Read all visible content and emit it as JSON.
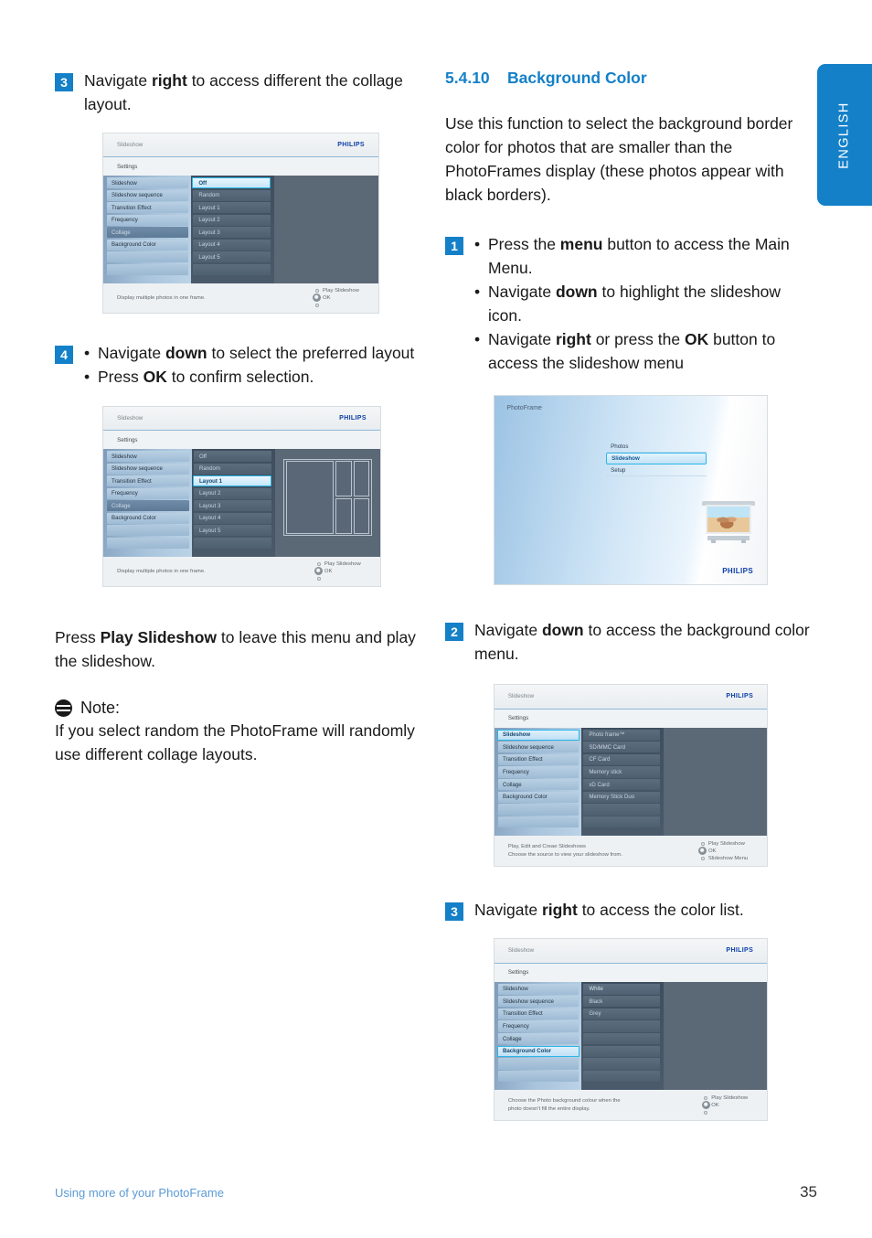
{
  "lang_tab": {
    "label": "ENGLISH"
  },
  "left_column": {
    "step3": {
      "badge": "3",
      "text_parts": [
        "Navigate ",
        "right",
        " to access different the collage layout."
      ],
      "full_text": "Navigate right to access different the collage layout."
    },
    "screenshot1": {
      "title": "Slideshow",
      "brand": "PHILIPS",
      "subtitle": "Settings",
      "menu_items": [
        "Slideshow",
        "Slideshow sequence",
        "Transition Effect",
        "Frequency",
        "Collage",
        "Background Color"
      ],
      "menu_selected": "Collage",
      "options": [
        "Off",
        "Random",
        "Layout 1",
        "Layout 2",
        "Layout 3",
        "Layout 4",
        "Layout 5"
      ],
      "option_selected": "Off",
      "footer_text": "Display multiple photos in one frame.",
      "controls": [
        "Play Slideshow",
        "OK"
      ]
    },
    "step4": {
      "badge": "4",
      "bullets": [
        "Navigate down to select the preferred layout",
        "Press OK to confirm selection."
      ]
    },
    "screenshot2": {
      "title": "Slideshow",
      "brand": "PHILIPS",
      "subtitle": "Settings",
      "menu_items": [
        "Slideshow",
        "Slideshow sequence",
        "Transition Effect",
        "Frequency",
        "Collage",
        "Background Color"
      ],
      "menu_selected": "Collage",
      "options": [
        "Off",
        "Random",
        "Layout 1",
        "Layout 2",
        "Layout 3",
        "Layout 4",
        "Layout 5"
      ],
      "option_selected": "Layout 1",
      "preview": "collage-layout-1-preview",
      "footer_text": "Display multiple photos in one frame.",
      "controls": [
        "Play Slideshow",
        "OK"
      ]
    },
    "closing_paragraph": "Press Play Slideshow to leave this menu and play the slideshow.",
    "note": {
      "label": "Note:",
      "body": "If you select random the PhotoFrame will randomly use different collage layouts."
    }
  },
  "right_column": {
    "section": {
      "number": "5.4.10",
      "title": "Background Color"
    },
    "intro": "Use this function to select the background border color for photos that are smaller than the PhotoFrames display (these photos appear with black borders).",
    "step1": {
      "badge": "1",
      "bullets": [
        "Press the menu button to access the Main Menu.",
        "Navigate down to highlight the slideshow icon.",
        "Navigate right or press the OK button to access the slideshow menu"
      ]
    },
    "screenshot3": {
      "title": "PhotoFrame",
      "brand": "PHILIPS",
      "items": [
        "Photos",
        "Slideshow",
        "Setup"
      ],
      "selected": "Slideshow",
      "thumbnail": "photo-frame-device-thumbnail"
    },
    "step2": {
      "badge": "2",
      "text": "Navigate down to access the background color menu."
    },
    "screenshot4": {
      "title": "Slideshow",
      "brand": "PHILIPS",
      "subtitle": "Settings",
      "menu_items": [
        "Slideshow",
        "Slideshow sequence",
        "Transition Effect",
        "Frequency",
        "Collage",
        "Background Color"
      ],
      "menu_selected": "Slideshow",
      "options": [
        "Photo frame™",
        "SD/MMC Card",
        "CF Card",
        "Memory stick",
        "xD Card",
        "Memory Stick Duo"
      ],
      "footer_line1": "Play, Edit and Creae Slideshows",
      "footer_line2": "Choose the source to view your slideshow from.",
      "controls": [
        "Play Slideshow",
        "OK",
        "Slideshow Menu"
      ]
    },
    "step3": {
      "badge": "3",
      "text": "Navigate right to access the color list."
    },
    "screenshot5": {
      "title": "Slideshow",
      "brand": "PHILIPS",
      "subtitle": "Settings",
      "menu_items": [
        "Slideshow",
        "Slideshow sequence",
        "Transition Effect",
        "Frequency",
        "Collage",
        "Background Color"
      ],
      "menu_selected": "Background Color",
      "options": [
        "White",
        "Black",
        "Grey"
      ],
      "footer_line1": "Choose the Photo background colour when the",
      "footer_line2": "photo doesn't fill the entire display.",
      "controls": [
        "Play Slideshow",
        "OK"
      ]
    }
  },
  "footer": {
    "left": "Using more of your PhotoFrame",
    "page": "35"
  },
  "colors": {
    "accent": "#1480c8",
    "philips_blue": "#0b3ea8",
    "footer_link": "#5a9bd5",
    "highlight_border": "#29b6e8"
  }
}
